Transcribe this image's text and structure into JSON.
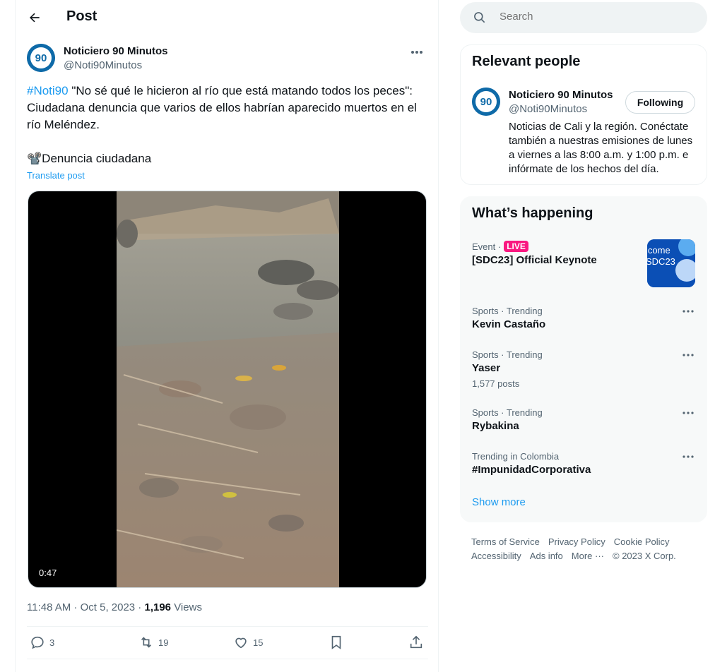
{
  "header": {
    "title": "Post"
  },
  "post": {
    "author_name": "Noticiero 90 Minutos",
    "author_handle": "@Noti90Minutos",
    "hashtag": "#Noti90",
    "text": " \"No sé qué le hicieron al río que está matando todos los peces\": Ciudadana denuncia que varios de ellos habrían aparecido muertos en el río Meléndez.\n\n📽️Denuncia ciudadana",
    "translate_label": "Translate post",
    "video_duration": "0:47",
    "timestamp": "11:48 AM · Oct 5, 2023 · ",
    "views_count": "1,196",
    "views_label": " Views",
    "replies": "3",
    "reposts": "19",
    "likes": "15"
  },
  "search": {
    "placeholder": "Search"
  },
  "relevant_people": {
    "title": "Relevant people",
    "name": "Noticiero 90 Minutos",
    "handle": "@Noti90Minutos",
    "follow_label": "Following",
    "bio": "Noticias de Cali y la región. Conéctate también a nuestras emisiones de lunes a viernes a las 8:00 a.m. y 1:00 p.m. e infórmate de los hechos del día."
  },
  "whats_happening": {
    "title": "What’s happening",
    "event": {
      "category": "Event · ",
      "live_label": "LIVE",
      "name": "[SDC23] Official Keynote",
      "thumb_text_1": "lcome",
      "thumb_text_2": "SDC23"
    },
    "trends": [
      {
        "meta": "Sports · Trending",
        "name": "Kevin Castaño",
        "count": ""
      },
      {
        "meta": "Sports · Trending",
        "name": "Yaser",
        "count": "1,577 posts"
      },
      {
        "meta": "Sports · Trending",
        "name": "Rybakina",
        "count": ""
      },
      {
        "meta": "Trending in Colombia",
        "name": "#ImpunidadCorporativa",
        "count": ""
      }
    ],
    "show_more": "Show more"
  },
  "footer": {
    "links": [
      "Terms of Service",
      "Privacy Policy",
      "Cookie Policy",
      "Accessibility",
      "Ads info",
      "More ···"
    ],
    "copyright": "© 2023 X Corp."
  }
}
